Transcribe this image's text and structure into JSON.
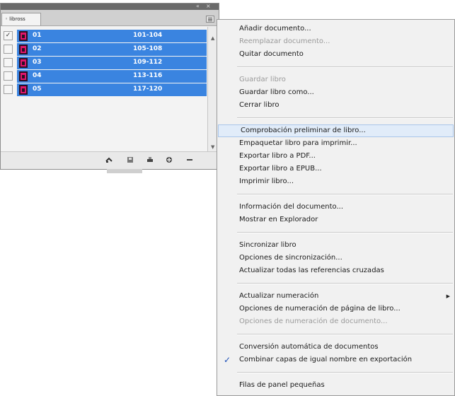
{
  "panel": {
    "tab_label": "libross",
    "close_glyph": "×",
    "collapse_glyph": "«",
    "rows": [
      {
        "name": "01",
        "pages": "101-104",
        "checked": true
      },
      {
        "name": "02",
        "pages": "105-108",
        "checked": false
      },
      {
        "name": "03",
        "pages": "109-112",
        "checked": false
      },
      {
        "name": "04",
        "pages": "113-116",
        "checked": false
      },
      {
        "name": "05",
        "pages": "117-120",
        "checked": false
      }
    ],
    "row_check_glyph": "✓",
    "row_color": "#3a84e0",
    "bottom_icons": [
      "sync-icon",
      "save-icon",
      "print-icon",
      "add-icon",
      "remove-icon"
    ]
  },
  "menu": {
    "items": [
      {
        "label": "Añadir documento...",
        "enabled": true
      },
      {
        "label": "Reemplazar documento...",
        "enabled": false
      },
      {
        "label": "Quitar documento",
        "enabled": true
      },
      {
        "label": "Guardar libro",
        "enabled": false
      },
      {
        "label": "Guardar libro como...",
        "enabled": true
      },
      {
        "label": "Cerrar libro",
        "enabled": true
      },
      {
        "label": "Comprobación preliminar de libro...",
        "enabled": true,
        "highlighted": true
      },
      {
        "label": "Empaquetar libro para imprimir...",
        "enabled": true
      },
      {
        "label": "Exportar libro a PDF...",
        "enabled": true
      },
      {
        "label": "Exportar libro a EPUB...",
        "enabled": true
      },
      {
        "label": "Imprimir libro...",
        "enabled": true
      },
      {
        "label": "Información del documento...",
        "enabled": true
      },
      {
        "label": "Mostrar en Explorador",
        "enabled": true
      },
      {
        "label": "Sincronizar libro",
        "enabled": true
      },
      {
        "label": "Opciones de sincronización...",
        "enabled": true
      },
      {
        "label": "Actualizar todas las referencias cruzadas",
        "enabled": true
      },
      {
        "label": "Actualizar numeración",
        "enabled": true,
        "submenu": true
      },
      {
        "label": "Opciones de numeración de página de libro...",
        "enabled": true
      },
      {
        "label": "Opciones de numeración de documento...",
        "enabled": false
      },
      {
        "label": "Conversión automática de documentos",
        "enabled": true
      },
      {
        "label": "Combinar capas de igual nombre en exportación",
        "enabled": true,
        "checked": true
      },
      {
        "label": "Filas de panel pequeñas",
        "enabled": true
      }
    ],
    "submenu_glyph": "▶",
    "check_glyph": "✓",
    "highlight_color": "#e1ecf9"
  }
}
